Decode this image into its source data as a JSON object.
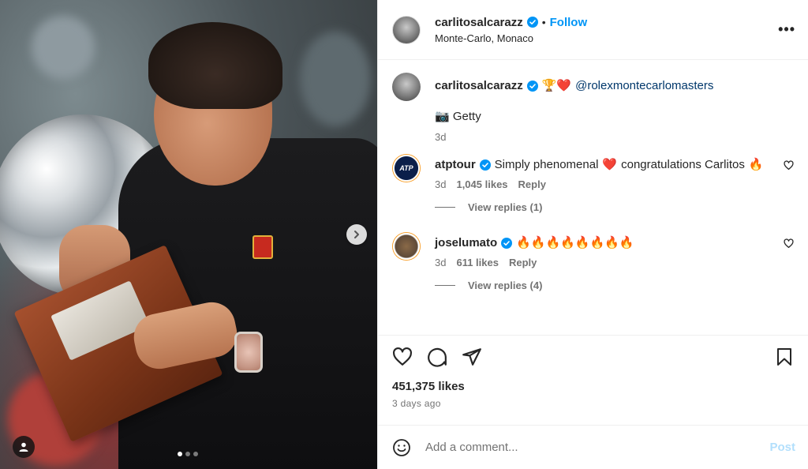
{
  "post": {
    "author": "carlitosalcarazz",
    "separator": "•",
    "follow_label": "Follow",
    "location": "Monte-Carlo, Monaco",
    "more_icon": "more-horizontal-icon",
    "media": {
      "slide_count": 3,
      "active_slide": 1
    }
  },
  "caption": {
    "author": "carlitosalcarazz",
    "emojis": "🏆❤️",
    "mention": "@rolexmontecarlomasters",
    "credit": "📷 Getty",
    "age": "3d"
  },
  "comments": [
    {
      "author": "atptour",
      "text_part1": "Simply phenomenal",
      "emoji": "❤️",
      "text_part2": "congratulations Carlitos",
      "emoji2": "🔥",
      "age": "3d",
      "likes": "1,045 likes",
      "reply_label": "Reply",
      "view_replies": "View replies (1)"
    },
    {
      "author": "joselumato",
      "text": "🔥🔥🔥🔥🔥🔥🔥🔥",
      "age": "3d",
      "likes": "611 likes",
      "reply_label": "Reply",
      "view_replies": "View replies (4)"
    }
  ],
  "actions": {
    "like_icon": "heart-outline-icon",
    "comment_icon": "comment-bubble-icon",
    "share_icon": "paper-plane-icon",
    "save_icon": "bookmark-icon",
    "likes": "451,375 likes",
    "time": "3 days ago"
  },
  "composer": {
    "placeholder": "Add a comment...",
    "post_label": "Post",
    "emoji_icon": "smiley-face-icon"
  },
  "colors": {
    "accent": "#0095f6",
    "verified": "#0095f6",
    "mention": "#00376b",
    "muted": "#737373",
    "heart_red": "#ed1c40"
  }
}
